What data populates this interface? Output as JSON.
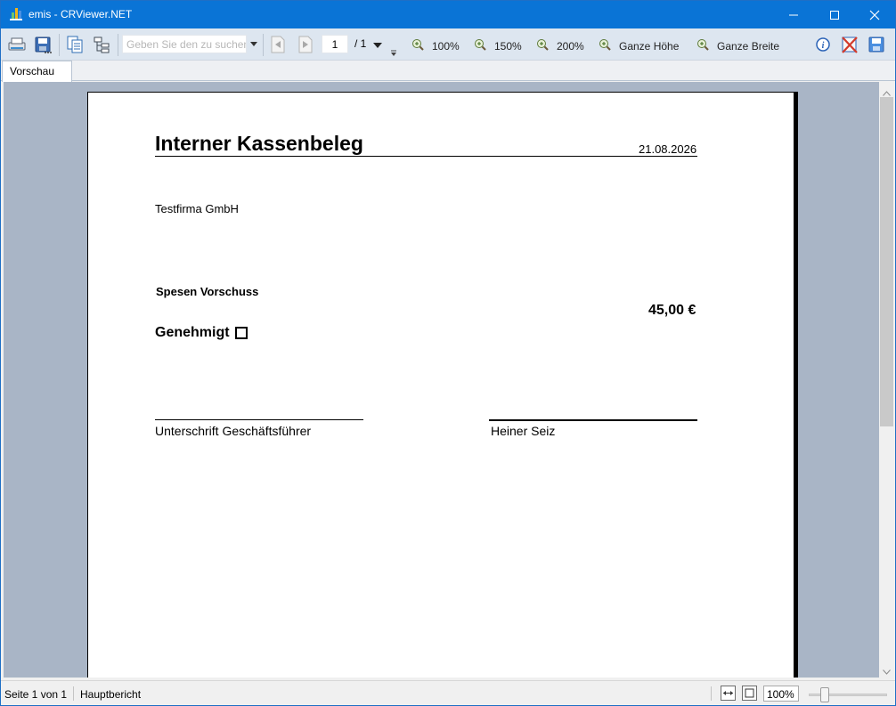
{
  "window": {
    "title": "emis - CRViewer.NET"
  },
  "toolbar": {
    "search_placeholder": "Geben Sie den zu suchen",
    "current_page": "1",
    "total_pages": "/ 1",
    "zoom_buttons": [
      "100%",
      "150%",
      "200%",
      "Ganze Höhe",
      "Ganze Breite"
    ],
    "icons": [
      "print-icon",
      "export-icon",
      "copy-icon",
      "group-tree-icon",
      "previous-page-icon",
      "next-page-icon",
      "info-icon",
      "close-report-icon",
      "save-icon"
    ]
  },
  "tabs": [
    {
      "label": "Vorschau",
      "active": true
    }
  ],
  "document": {
    "title": "Interner Kassenbeleg",
    "date": "21.08.2026",
    "company": "Testfirma GmbH",
    "item_label": "Spesen Vorschuss",
    "amount": "45,00 €",
    "approved_label": "Genehmigt",
    "approved_checked": false,
    "signature_left": "Unterschrift Geschäftsführer",
    "signature_right": "Heiner Seiz"
  },
  "statusbar": {
    "page_info": "Seite 1 von 1",
    "report_name": "Hauptbericht",
    "zoom": "100%",
    "zoom_slider_fraction": 0.17
  },
  "colors": {
    "titlebar": "#0a74d6",
    "toolbar": "#dde6f0",
    "preview_bg": "#a9b5c6"
  }
}
